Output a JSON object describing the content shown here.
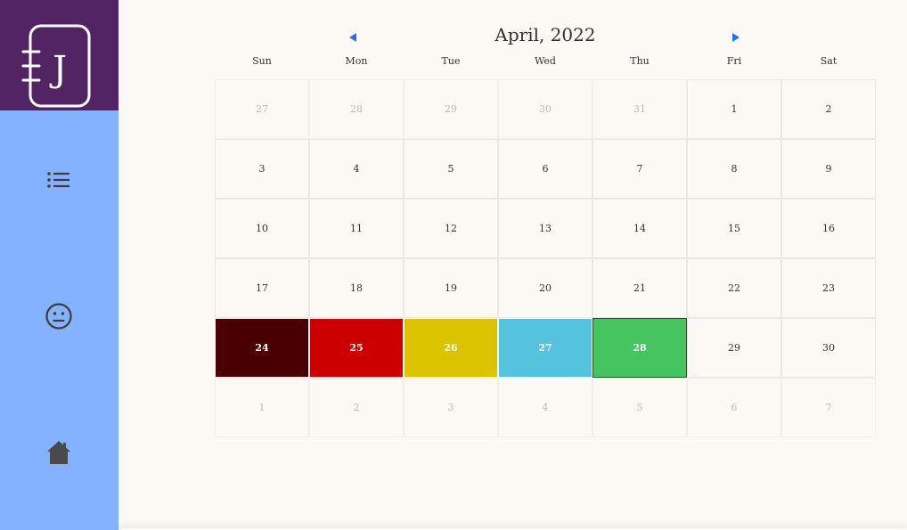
{
  "sidebar": {
    "logo_letter": "J",
    "colors": {
      "background": "#84b2fe",
      "logo_background": "#522463",
      "icon_color": "#3d3d3d"
    },
    "items": [
      {
        "icon": "list-icon"
      },
      {
        "icon": "neutral-face-icon"
      },
      {
        "icon": "home-icon"
      }
    ]
  },
  "calendar": {
    "title": "April, 2022",
    "nav_color": "#1f74e6",
    "weekdays": [
      "Sun",
      "Mon",
      "Tue",
      "Wed",
      "Thu",
      "Fri",
      "Sat"
    ],
    "selected_day": "28",
    "weeks": [
      [
        {
          "day": "27",
          "current": false
        },
        {
          "day": "28",
          "current": false
        },
        {
          "day": "29",
          "current": false
        },
        {
          "day": "30",
          "current": false
        },
        {
          "day": "31",
          "current": false
        },
        {
          "day": "1",
          "current": true
        },
        {
          "day": "2",
          "current": true
        }
      ],
      [
        {
          "day": "3",
          "current": true
        },
        {
          "day": "4",
          "current": true
        },
        {
          "day": "5",
          "current": true
        },
        {
          "day": "6",
          "current": true
        },
        {
          "day": "7",
          "current": true
        },
        {
          "day": "8",
          "current": true
        },
        {
          "day": "9",
          "current": true
        }
      ],
      [
        {
          "day": "10",
          "current": true
        },
        {
          "day": "11",
          "current": true
        },
        {
          "day": "12",
          "current": true
        },
        {
          "day": "13",
          "current": true
        },
        {
          "day": "14",
          "current": true
        },
        {
          "day": "15",
          "current": true
        },
        {
          "day": "16",
          "current": true
        }
      ],
      [
        {
          "day": "17",
          "current": true
        },
        {
          "day": "18",
          "current": true
        },
        {
          "day": "19",
          "current": true
        },
        {
          "day": "20",
          "current": true
        },
        {
          "day": "21",
          "current": true
        },
        {
          "day": "22",
          "current": true
        },
        {
          "day": "23",
          "current": true
        }
      ],
      [
        {
          "day": "24",
          "current": true,
          "color": "#4a0000"
        },
        {
          "day": "25",
          "current": true,
          "color": "#cc0000"
        },
        {
          "day": "26",
          "current": true,
          "color": "#dbc300"
        },
        {
          "day": "27",
          "current": true,
          "color": "#55c3dd"
        },
        {
          "day": "28",
          "current": true,
          "color": "#45c45f"
        },
        {
          "day": "29",
          "current": true
        },
        {
          "day": "30",
          "current": true
        }
      ],
      [
        {
          "day": "1",
          "current": false
        },
        {
          "day": "2",
          "current": false
        },
        {
          "day": "3",
          "current": false
        },
        {
          "day": "4",
          "current": false
        },
        {
          "day": "5",
          "current": false
        },
        {
          "day": "6",
          "current": false
        },
        {
          "day": "7",
          "current": false
        }
      ]
    ]
  }
}
